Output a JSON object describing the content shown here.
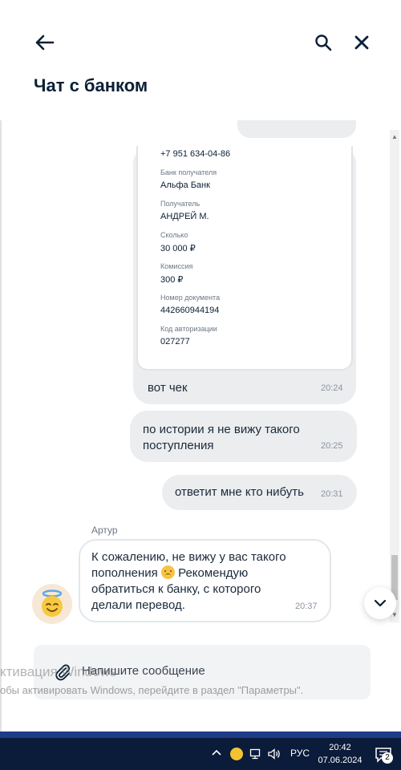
{
  "header": {
    "title": "Чат с банком"
  },
  "receipt": {
    "phone": "+7 951 634-04-86",
    "fields": [
      {
        "label": "Банк получателя",
        "value": "Альфа Банк"
      },
      {
        "label": "Получатель",
        "value": "АНДРЕЙ М."
      },
      {
        "label": "Сколько",
        "value": "30 000 ₽"
      },
      {
        "label": "Комиссия",
        "value": "300 ₽"
      },
      {
        "label": "Номер документа",
        "value": "442660944194"
      },
      {
        "label": "Код авторизации",
        "value": "027277"
      }
    ],
    "caption": "вот чек",
    "time": "20:24"
  },
  "messages": [
    {
      "text": "по истории я не вижу такого поступления",
      "time": "20:25"
    },
    {
      "text": "ответит мне кто нибуть",
      "time": "20:31"
    }
  ],
  "incoming": {
    "sender": "Артур",
    "text_before": "К сожалению, не вижу у вас такого пополнения",
    "emoji": "sad-face-emoji",
    "text_after": "Рекомендую обратиться к банку, с которого делали перевод.",
    "time": "20:37",
    "avatar": "angel-face-emoji"
  },
  "composer": {
    "placeholder": "Напишите сообщение"
  },
  "watermark": {
    "line1": "ктивация Windows",
    "line2": "обы активировать Windows, перейдите в раздел \"Параметры\"."
  },
  "taskbar": {
    "language": "РУС",
    "time": "20:42",
    "date": "07.06.2024",
    "notification_count": "2"
  },
  "colors": {
    "bubble": "#ebedef",
    "title": "#0b1f35",
    "taskbar": "#0b1b3a"
  }
}
